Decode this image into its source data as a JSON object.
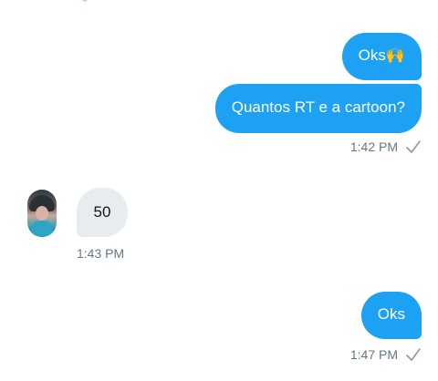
{
  "messages": [
    {
      "direction": "outgoing",
      "text": "Oks🙌"
    },
    {
      "direction": "outgoing",
      "text": "Quantos RT e a cartoon?",
      "time": "1:42 PM",
      "status_icon": "check-icon"
    },
    {
      "direction": "incoming",
      "text": "50",
      "time": "1:43 PM",
      "avatar_icon": "avatar"
    },
    {
      "direction": "outgoing",
      "text": "Oks",
      "time": "1:47 PM",
      "status_icon": "check-icon"
    }
  ],
  "colors": {
    "outgoing_bubble": "#1da1f2",
    "incoming_bubble": "#e6ecf0",
    "timestamp": "#657786"
  }
}
